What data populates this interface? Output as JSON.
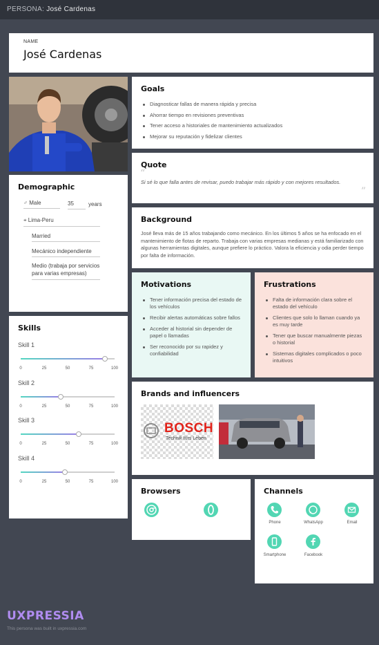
{
  "topbar": {
    "prefix": "PERSONA:",
    "name": "José Cardenas"
  },
  "persona": {
    "name_label": "NAME",
    "name": "José Cardenas"
  },
  "demographic": {
    "title": "Demographic",
    "gender": "Male",
    "age": "35",
    "age_unit": "years",
    "location": "Lima-Peru",
    "status": "Married",
    "occupation": "Mecánico independiente",
    "income": "Medio (trabaja por servicios para varias empresas)"
  },
  "skills": {
    "title": "Skills",
    "items": [
      {
        "label": "Skill 1",
        "value": 90
      },
      {
        "label": "Skill 2",
        "value": 43
      },
      {
        "label": "Skill 3",
        "value": 62
      },
      {
        "label": "Skill 4",
        "value": 47
      }
    ],
    "ticks": [
      "0",
      "25",
      "50",
      "75",
      "100"
    ],
    "colors": {
      "fill_start": "#52d6c0",
      "fill_end": "#9a7de6"
    }
  },
  "goals": {
    "title": "Goals",
    "items": [
      "Diagnosticar fallas de manera rápida y precisa",
      "Ahorrar tiempo en revisiones preventivas",
      "Tener acceso a historiales de mantenimiento actualizados",
      "Mejorar su reputación y fidelizar clientes"
    ]
  },
  "quote": {
    "title": "Quote",
    "text": "Si sé lo que falla antes de revisar, puedo trabajar más rápido y con mejores resultados."
  },
  "background": {
    "title": "Background",
    "text": "José lleva más de 15 años trabajando como mecánico. En los últimos 5 años se ha enfocado en el mantenimiento de flotas de reparto. Trabaja con varias empresas medianas y está familiarizado con algunas herramientas digitales, aunque prefiere lo práctico. Valora la eficiencia y odia perder tiempo por falta de información."
  },
  "motivations": {
    "title": "Motivations",
    "items": [
      "Tener información precisa del estado de los vehículos",
      "Recibir alertas automáticas sobre fallos",
      "Acceder al historial sin depender de papel o llamadas",
      "Ser reconocido por su rapidez y confiabilidad"
    ]
  },
  "frustrations": {
    "title": "Frustrations",
    "items": [
      "Falta de información clara sobre el estado del vehículo",
      "Clientes que solo lo llaman cuando ya es muy tarde",
      "Tener que buscar manualmente piezas o historial",
      "Sistemas digitales complicados o poco intuitivos"
    ]
  },
  "brands": {
    "title": "Brands and influencers",
    "bosch_name": "BOSCH",
    "bosch_tagline": "Technik fürs Leben"
  },
  "browsers": {
    "title": "Browsers",
    "items": [
      "chrome-icon",
      "opera-icon"
    ]
  },
  "channels": {
    "title": "Channels",
    "items": [
      {
        "label": "Phone",
        "icon": "phone-icon"
      },
      {
        "label": "WhatsApp",
        "icon": "whatsapp-icon"
      },
      {
        "label": "Email",
        "icon": "email-icon"
      },
      {
        "label": "Smartphone",
        "icon": "smartphone-icon"
      },
      {
        "label": "Facebook",
        "icon": "facebook-icon"
      }
    ]
  },
  "footer": {
    "logo": "UXPRESSIA",
    "note": "This persona was built in uxpressia.com"
  },
  "colors": {
    "accent": "#52d6b3",
    "motivations_bg": "#e9f8f4",
    "frustrations_bg": "#fbe2dc",
    "page_bg": "#424752"
  }
}
